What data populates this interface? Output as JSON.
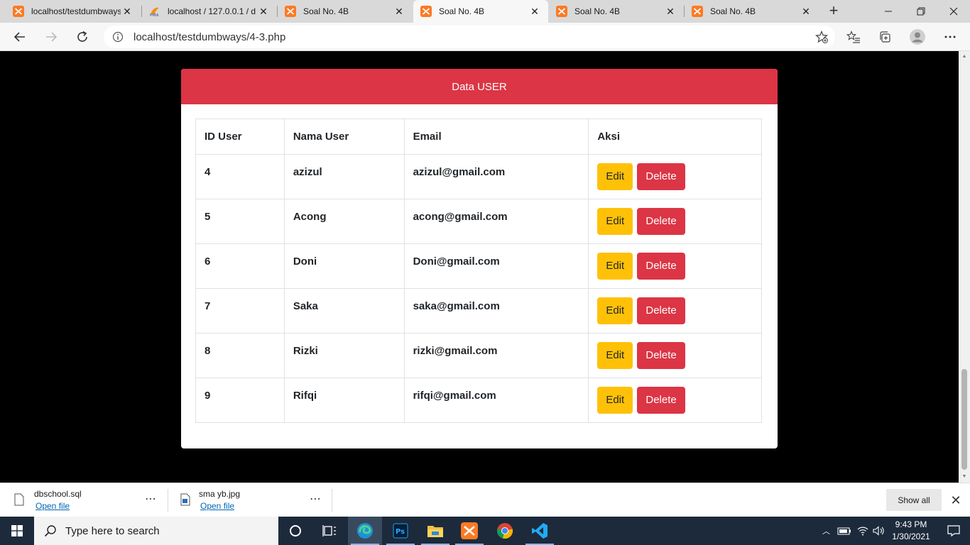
{
  "browser": {
    "tabs": [
      {
        "title": "localhost/testdumbways/",
        "icon": "xampp-icon",
        "active": false
      },
      {
        "title": "localhost / 127.0.0.1 / d",
        "icon": "phpmyadmin-icon",
        "active": false
      },
      {
        "title": "Soal No. 4B",
        "icon": "xampp-icon",
        "active": false
      },
      {
        "title": "Soal No. 4B",
        "icon": "xampp-icon",
        "active": true
      },
      {
        "title": "Soal No. 4B",
        "icon": "xampp-icon",
        "active": false
      },
      {
        "title": "Soal No. 4B",
        "icon": "xampp-icon",
        "active": false
      }
    ],
    "url": "localhost/testdumbways/4-3.php"
  },
  "page": {
    "card_title": "Data USER",
    "columns": [
      "ID User",
      "Nama User",
      "Email",
      "Aksi"
    ],
    "rows": [
      {
        "id": "4",
        "name": "azizul",
        "email": "azizul@gmail.com"
      },
      {
        "id": "5",
        "name": "Acong",
        "email": "acong@gmail.com"
      },
      {
        "id": "6",
        "name": "Doni",
        "email": "Doni@gmail.com"
      },
      {
        "id": "7",
        "name": "Saka",
        "email": "saka@gmail.com"
      },
      {
        "id": "8",
        "name": "Rizki",
        "email": "rizki@gmail.com"
      },
      {
        "id": "9",
        "name": "Rifqi",
        "email": "rifqi@gmail.com"
      }
    ],
    "edit_label": "Edit",
    "delete_label": "Delete"
  },
  "downloads": {
    "items": [
      {
        "filename": "dbschool.sql",
        "action": "Open file",
        "icon": "file-icon"
      },
      {
        "filename": "sma yb.jpg",
        "action": "Open file",
        "icon": "image-file-icon"
      }
    ],
    "show_all": "Show all"
  },
  "taskbar": {
    "search_placeholder": "Type here to search",
    "apps": [
      "cortana-icon",
      "task-view-icon",
      "edge-icon",
      "photoshop-icon",
      "file-explorer-icon",
      "xampp-icon",
      "chrome-icon",
      "vscode-icon"
    ],
    "time": "9:43 PM",
    "date": "1/30/2021"
  },
  "colors": {
    "danger": "#dc3545",
    "warning": "#ffc107",
    "taskbar": "#1c2a3c"
  }
}
